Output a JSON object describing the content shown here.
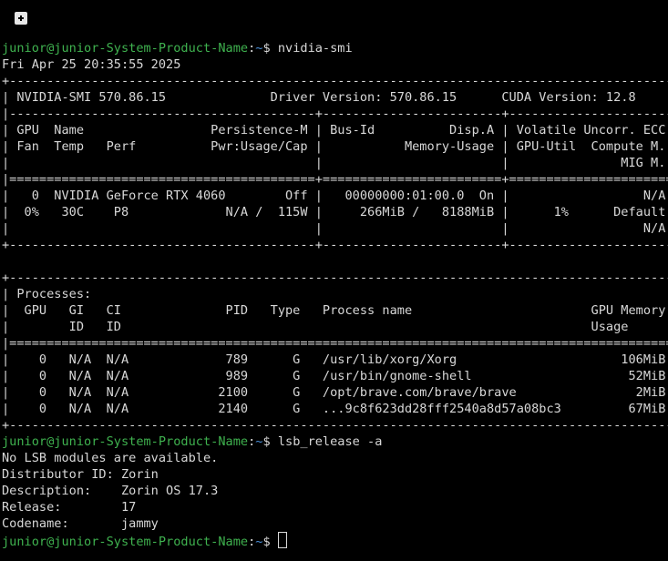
{
  "toolbar": {
    "new_tab_icon": "new-tab-icon"
  },
  "prompt": {
    "user_host": "junior@junior-System-Product-Name",
    "sep": ":",
    "path": "~",
    "symbol": "$ "
  },
  "lines": [
    {
      "type": "prompt",
      "cmd": "nvidia-smi"
    },
    {
      "type": "text",
      "text": "Fri Apr 25 20:35:55 2025"
    },
    {
      "type": "text",
      "text": "+-----------------------------------------------------------------------------------------+"
    },
    {
      "type": "text",
      "text": "| NVIDIA-SMI 570.86.15              Driver Version: 570.86.15      CUDA Version: 12.8     |"
    },
    {
      "type": "text",
      "text": "|-----------------------------------------+------------------------+----------------------+"
    },
    {
      "type": "text",
      "text": "| GPU  Name                 Persistence-M | Bus-Id          Disp.A | Volatile Uncorr. ECC |"
    },
    {
      "type": "text",
      "text": "| Fan  Temp   Perf          Pwr:Usage/Cap |           Memory-Usage | GPU-Util  Compute M. |"
    },
    {
      "type": "text",
      "text": "|                                         |                        |               MIG M. |"
    },
    {
      "type": "text",
      "text": "|=========================================+========================+======================|"
    },
    {
      "type": "text",
      "text": "|   0  NVIDIA GeForce RTX 4060        Off |   00000000:01:00.0  On |                  N/A |"
    },
    {
      "type": "text",
      "text": "|  0%   30C    P8             N/A /  115W |     266MiB /   8188MiB |      1%      Default |"
    },
    {
      "type": "text",
      "text": "|                                         |                        |                  N/A |"
    },
    {
      "type": "text",
      "text": "+-----------------------------------------+------------------------+----------------------+"
    },
    {
      "type": "text",
      "text": ""
    },
    {
      "type": "text",
      "text": "+-----------------------------------------------------------------------------------------+"
    },
    {
      "type": "text",
      "text": "| Processes:                                                                              |"
    },
    {
      "type": "text",
      "text": "|  GPU   GI   CI              PID   Type   Process name                        GPU Memory |"
    },
    {
      "type": "text",
      "text": "|        ID   ID                                                               Usage      |"
    },
    {
      "type": "text",
      "text": "|=========================================================================================|"
    },
    {
      "type": "text",
      "text": "|    0   N/A  N/A             789      G   /usr/lib/xorg/Xorg                      106MiB |"
    },
    {
      "type": "text",
      "text": "|    0   N/A  N/A             989      G   /usr/bin/gnome-shell                     52MiB |"
    },
    {
      "type": "text",
      "text": "|    0   N/A  N/A            2100      G   /opt/brave.com/brave/brave                2MiB |"
    },
    {
      "type": "text",
      "text": "|    0   N/A  N/A            2140      G   ...9c8f623dd28fff2540a8d57a08bc3         67MiB |"
    },
    {
      "type": "text",
      "text": "+-----------------------------------------------------------------------------------------+"
    },
    {
      "type": "prompt",
      "cmd": "lsb_release -a"
    },
    {
      "type": "text",
      "text": "No LSB modules are available."
    },
    {
      "type": "text",
      "text": "Distributor ID: Zorin"
    },
    {
      "type": "text",
      "text": "Description:    Zorin OS 17.3"
    },
    {
      "type": "text",
      "text": "Release:        17"
    },
    {
      "type": "text",
      "text": "Codename:       jammy"
    },
    {
      "type": "prompt",
      "cmd": "",
      "cursor": true
    }
  ]
}
